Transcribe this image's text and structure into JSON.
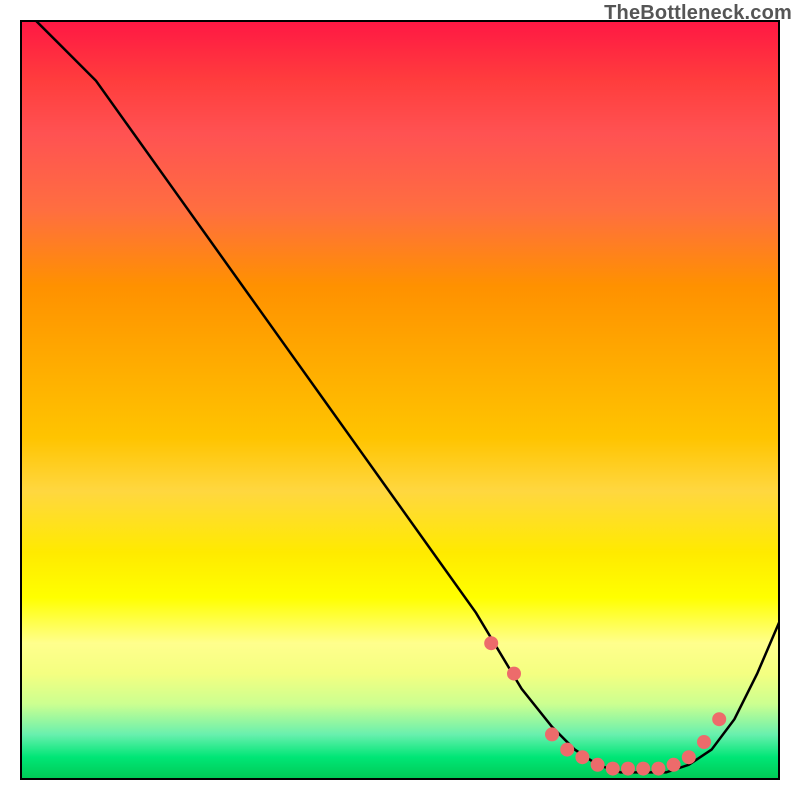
{
  "attribution": "TheBottleneck.com",
  "chart_data": {
    "type": "line",
    "title": "",
    "xlabel": "",
    "ylabel": "",
    "xlim": [
      0,
      100
    ],
    "ylim": [
      0,
      100
    ],
    "series": [
      {
        "name": "curve",
        "x": [
          2,
          5,
          10,
          15,
          20,
          25,
          30,
          35,
          40,
          45,
          50,
          55,
          60,
          63,
          66,
          70,
          73,
          76,
          79,
          82,
          85,
          88,
          91,
          94,
          97,
          100
        ],
        "y": [
          100,
          97,
          92,
          85,
          78,
          71,
          64,
          57,
          50,
          43,
          36,
          29,
          22,
          17,
          12,
          7,
          4,
          2,
          1,
          1,
          1,
          2,
          4,
          8,
          14,
          21
        ]
      }
    ],
    "markers": {
      "name": "highlight-dots",
      "x": [
        62,
        65,
        70,
        72,
        74,
        76,
        78,
        80,
        82,
        84,
        86,
        88,
        90,
        92
      ],
      "y": [
        18,
        14,
        6,
        4,
        3,
        2,
        1.5,
        1.5,
        1.5,
        1.5,
        2,
        3,
        5,
        8
      ]
    },
    "gradient_stops": [
      {
        "pos": 0,
        "color": "#ff1744"
      },
      {
        "pos": 50,
        "color": "#ffc400"
      },
      {
        "pos": 80,
        "color": "#ffff00"
      },
      {
        "pos": 100,
        "color": "#00c853"
      }
    ]
  }
}
